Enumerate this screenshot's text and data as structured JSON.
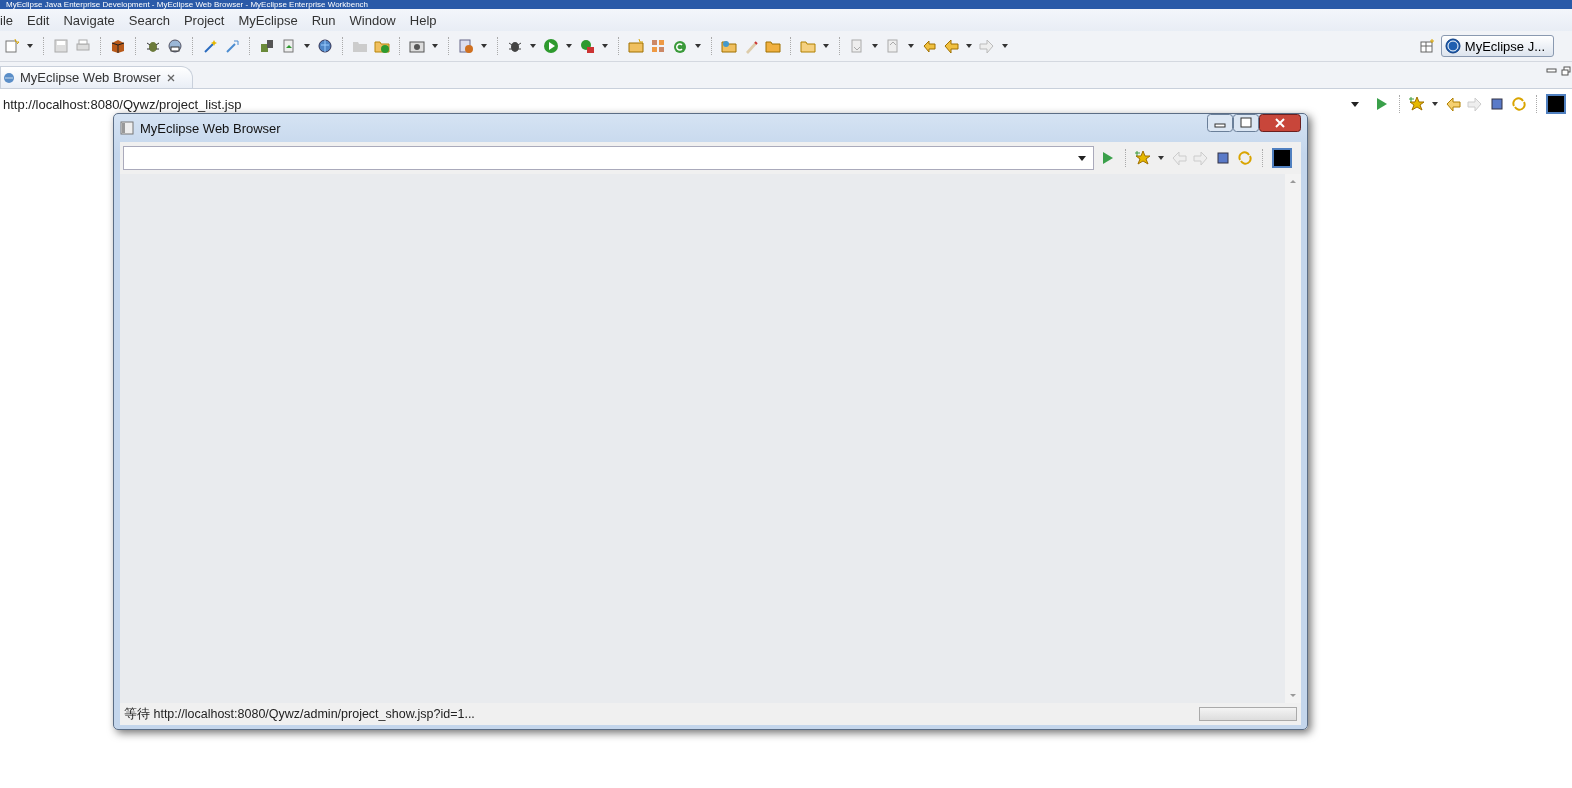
{
  "window": {
    "title": "MyEclipse Java Enterprise Development - MyEclipse Web Browser - MyEclipse Enterprise Workbench"
  },
  "menu_bar": [
    "ile",
    "Edit",
    "Navigate",
    "Search",
    "Project",
    "MyEclipse",
    "Run",
    "Window",
    "Help"
  ],
  "perspective_button": {
    "label": "MyEclipse J..."
  },
  "editor_tabs": [
    {
      "label": "MyEclipse Web Browser",
      "selected": true
    }
  ],
  "browser_bar": {
    "url": "http://localhost:8080/Qywz/project_list.jsp"
  },
  "popup_window": {
    "title": "MyEclipse Web Browser",
    "status_text": "等待 http://localhost:8080/Qywz/admin/project_show.jsp?id=1...",
    "progress": {
      "level": 0
    }
  }
}
